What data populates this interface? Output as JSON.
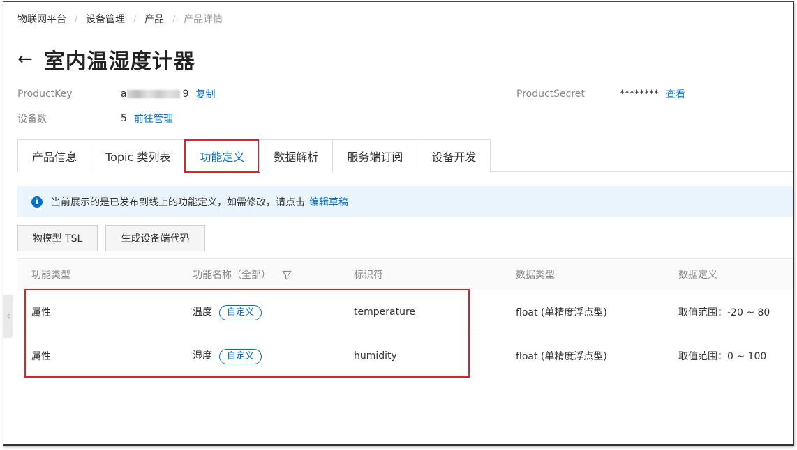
{
  "breadcrumb": {
    "items": [
      "物联网平台",
      "设备管理",
      "产品"
    ],
    "current": "产品详情",
    "separator": "/"
  },
  "header": {
    "title": "室内温湿度计器"
  },
  "product": {
    "product_key_label": "ProductKey",
    "product_key_value_suffix": "9",
    "product_key_prefix": "a",
    "copy_label": "复制",
    "product_secret_label": "ProductSecret",
    "product_secret_value": "********",
    "view_label": "查看",
    "device_count_label": "设备数",
    "device_count_value": "5",
    "manage_label": "前往管理"
  },
  "tabs": [
    {
      "label": "产品信息",
      "active": false
    },
    {
      "label": "Topic 类列表",
      "active": false
    },
    {
      "label": "功能定义",
      "active": true
    },
    {
      "label": "数据解析",
      "active": false
    },
    {
      "label": "服务端订阅",
      "active": false
    },
    {
      "label": "设备开发",
      "active": false
    }
  ],
  "notice": {
    "text": "当前展示的是已发布到线上的功能定义，如需修改，请点击",
    "link": "编辑草稿"
  },
  "buttons": {
    "tsl": "物模型 TSL",
    "generate_code": "生成设备端代码"
  },
  "table": {
    "columns": [
      "功能类型",
      "功能名称（全部）",
      "标识符",
      "数据类型",
      "数据定义"
    ],
    "rows": [
      {
        "type": "属性",
        "name": "温度",
        "tag": "自定义",
        "identifier": "temperature",
        "data_type": "float (单精度浮点型)",
        "definition": "取值范围：-20 ~ 80"
      },
      {
        "type": "属性",
        "name": "湿度",
        "tag": "自定义",
        "identifier": "humidity",
        "data_type": "float (单精度浮点型)",
        "definition": "取值范围：0 ~ 100"
      }
    ]
  },
  "colors": {
    "accent": "#0070cc",
    "highlight": "#d9232d",
    "notice_bg": "#e9f4fd"
  }
}
